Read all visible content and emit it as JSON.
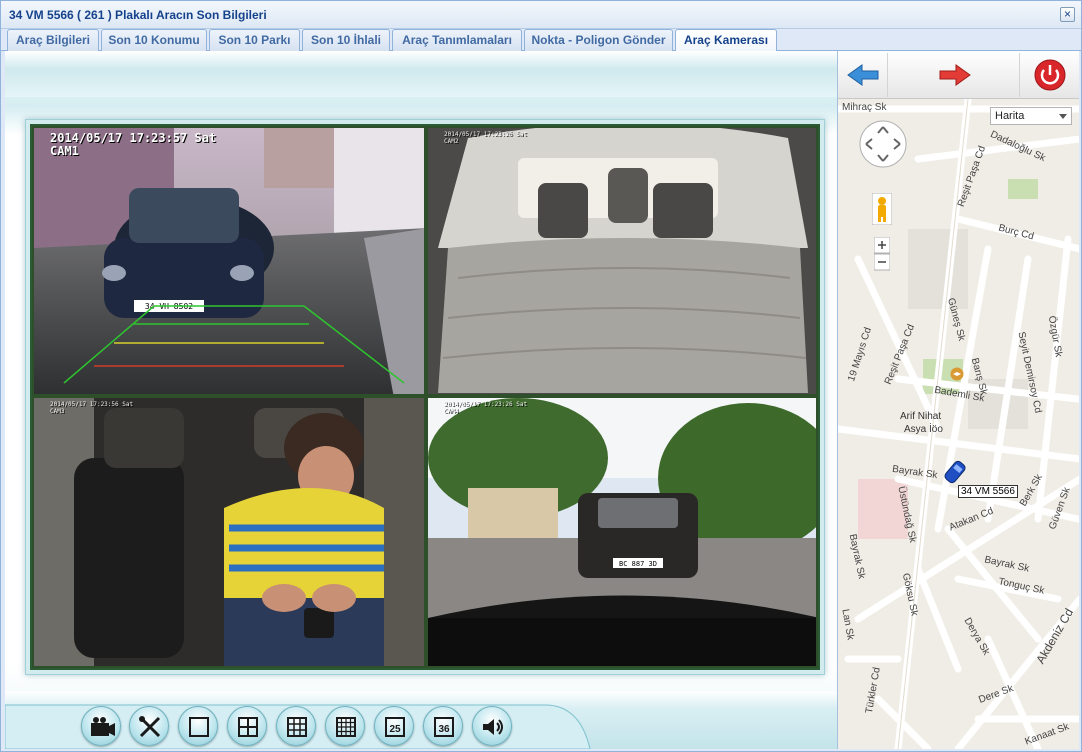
{
  "window": {
    "title": "34 VM 5566 ( 261 ) Plakalı Aracın Son Bilgileri",
    "close_symbol": "×"
  },
  "tabs": [
    {
      "label": "Araç Bilgileri",
      "active": false
    },
    {
      "label": "Son 10 Konumu",
      "active": false
    },
    {
      "label": "Son 10 Parkı",
      "active": false
    },
    {
      "label": "Son 10 İhlali",
      "active": false
    },
    {
      "label": "Araç Tanımlamaları",
      "active": false
    },
    {
      "label": "Nokta - Poligon Gönder",
      "active": false
    },
    {
      "label": "Araç Kamerası",
      "active": true
    }
  ],
  "cameras": [
    {
      "timestamp": "2014/05/17  17:23:57 Sat",
      "name": "CAM1"
    },
    {
      "timestamp": "2014/05/17  17:23:26 Sat",
      "name": "CAM2"
    },
    {
      "timestamp": "2014/05/17  17:23:56 Sat",
      "name": "CAM3"
    },
    {
      "timestamp": "2014/05/17  17:23:26 Sat",
      "name": "CAM4"
    }
  ],
  "cam1_plate": "34 VH 8502",
  "cam4_plate": "BC 887 3D",
  "toolbar": {
    "buttons": [
      {
        "icon": "camera-record-icon"
      },
      {
        "icon": "tools-icon"
      },
      {
        "icon": "layout-1-icon"
      },
      {
        "icon": "layout-4-icon"
      },
      {
        "icon": "layout-9-icon"
      },
      {
        "icon": "layout-16-icon"
      },
      {
        "icon": "layout-25-icon",
        "label": "25"
      },
      {
        "icon": "layout-36-icon",
        "label": "36"
      },
      {
        "icon": "speaker-icon"
      }
    ]
  },
  "map": {
    "type_select": "Harita",
    "vehicle_label": "34 VM 5566",
    "streets": [
      {
        "name": "Mihraç Sk"
      },
      {
        "name": "Dadaloğlu Sk"
      },
      {
        "name": "Reşit Paşa Cd"
      },
      {
        "name": "Burç Cd"
      },
      {
        "name": "19 Mayıs Cd"
      },
      {
        "name": "Güneş Sk"
      },
      {
        "name": "Özgür Sk"
      },
      {
        "name": "Reşit Paşa Cd"
      },
      {
        "name": "Barış Sk"
      },
      {
        "name": "Seyit Demirsoy Cd"
      },
      {
        "name": "Bademli Sk"
      },
      {
        "name": "Arif Nihat"
      },
      {
        "name": "Asya İöo"
      },
      {
        "name": "Bayrak Sk"
      },
      {
        "name": "Üstündağ Sk"
      },
      {
        "name": "Bayrak Sk"
      },
      {
        "name": "Atakan Cd"
      },
      {
        "name": "Güven Sk"
      },
      {
        "name": "Berk Sk"
      },
      {
        "name": "Bayrak Sk"
      },
      {
        "name": "Tonguç Sk"
      },
      {
        "name": "Göksu Sk"
      },
      {
        "name": "Derya Sk"
      },
      {
        "name": "Akdeniz Cd"
      },
      {
        "name": "Türkler Cd"
      },
      {
        "name": "Dere Sk"
      },
      {
        "name": "Kanaat Sk"
      },
      {
        "name": "Lan Sk"
      }
    ]
  }
}
